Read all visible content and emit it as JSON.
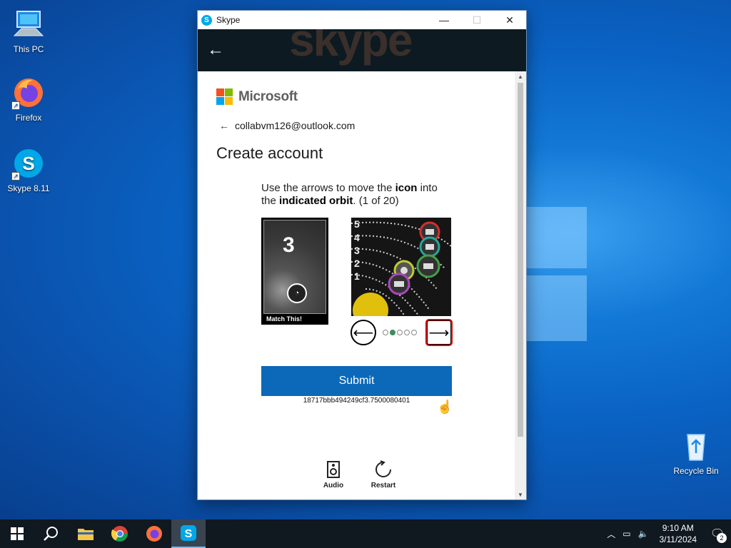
{
  "desktop": {
    "icons": [
      {
        "label": "This PC",
        "icon": "computer-icon"
      },
      {
        "label": "Firefox",
        "icon": "firefox-icon"
      },
      {
        "label": "Skype 8.11",
        "icon": "skype-icon"
      },
      {
        "label": "Recycle Bin",
        "icon": "recycle-bin-icon"
      }
    ]
  },
  "window": {
    "title": "Skype",
    "app_icon_letter": "S",
    "header_ghost_text": "skype",
    "controls": {
      "minimize": "—",
      "maximize": "☐",
      "close": "✕"
    }
  },
  "signin": {
    "brand": "Microsoft",
    "identity_email": "collabvm126@outlook.com",
    "heading": "Create account"
  },
  "puzzle": {
    "instruction_pre": "Use the arrows to move the ",
    "instruction_b1": "icon",
    "instruction_mid": " into the ",
    "instruction_b2": "indicated orbit",
    "instruction_post": ". (1 of 20)",
    "match_number": "3",
    "match_caption": "Match This!",
    "orbit_labels": [
      "5",
      "4",
      "3",
      "2",
      "1"
    ],
    "dots_total": 5,
    "dot_active_index": 1,
    "submit_label": "Submit",
    "session_id": "18717bbb494249cf3.7500080401"
  },
  "tools": {
    "audio_label": "Audio",
    "restart_label": "Restart"
  },
  "taskbar": {
    "time": "9:10 AM",
    "date": "3/11/2024",
    "notification_count": "2"
  },
  "colors": {
    "accent": "#0c68b8",
    "ms_red": "#f25022",
    "ms_green": "#7fba00",
    "ms_blue": "#00a4ef",
    "ms_yellow": "#ffb900"
  }
}
